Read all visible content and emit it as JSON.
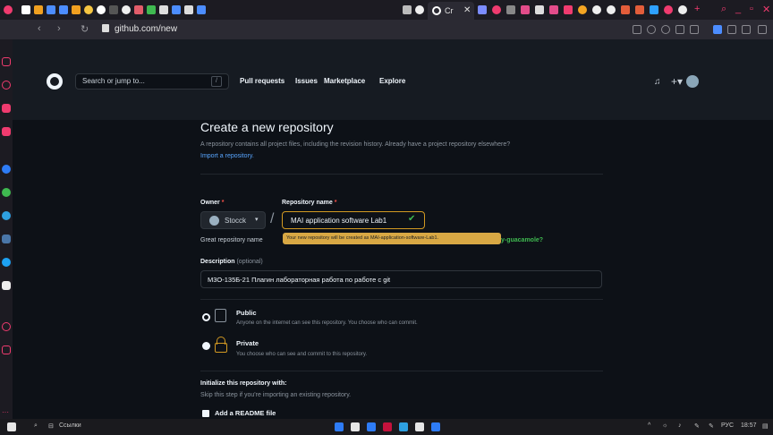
{
  "browser": {
    "active_tab_title": "Cr",
    "url": "github.com/new",
    "colors": {
      "tabstrip": "#1c1b22",
      "toolbar": "#2b2a33",
      "accent": "#f03b6f"
    }
  },
  "github_header": {
    "search_placeholder": "Search or jump to...",
    "search_shortcut": "/",
    "nav": [
      "Pull requests",
      "Issues",
      "Marketplace",
      "Explore"
    ]
  },
  "page": {
    "title": "Create a new repository",
    "subtitle": "A repository contains all project files, including the revision history. Already have a project repository elsewhere?",
    "import_link": "Import a repository.",
    "owner_label": "Owner",
    "repo_name_label": "Repository name",
    "required_mark": "*",
    "owner_value": "Stocck",
    "slash": "/",
    "repo_name_value": "MAI application software Lab1",
    "great_prefix": "Great repository name",
    "tooltip": "Your new repository will be created as MAI-application-software-Lab1.",
    "suggestion_tail": "y-guacamole?",
    "description_label": "Description",
    "description_optional": "(optional)",
    "description_value": "М3О-135Б-21 Плагин лабораторная работа по работе с git",
    "public_title": "Public",
    "public_desc": "Anyone on the internet can see this repository. You choose who can commit.",
    "private_title": "Private",
    "private_desc": "You choose who can see and commit to this repository.",
    "init_title": "Initialize this repository with:",
    "init_sub": "Skip this step if you're importing an existing repository.",
    "readme_label": "Add a README file",
    "selected_visibility": "Public",
    "colors": {
      "bg": "#0d1117",
      "header": "#161b22",
      "link": "#58a6ff",
      "success": "#3fb950",
      "warning": "#d29922",
      "required": "#f85149"
    }
  },
  "taskbar": {
    "links_label": "Ссылки",
    "language": "РУС",
    "time": "18:57"
  }
}
